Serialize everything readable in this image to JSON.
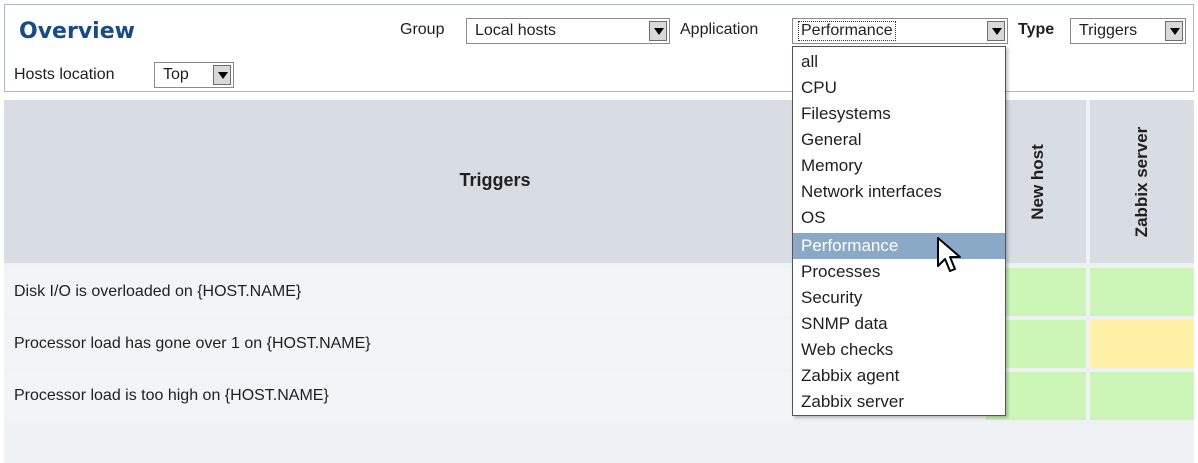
{
  "header": {
    "title": "Overview",
    "group_label": "Group",
    "group_value": "Local hosts",
    "application_label": "Application",
    "application_value": "Performance",
    "type_label": "Type",
    "type_value": "Triggers",
    "hosts_location_label": "Hosts location",
    "hosts_location_value": "Top"
  },
  "table": {
    "triggers_header": "Triggers",
    "hosts": [
      "New host",
      "Zabbix server"
    ],
    "rows": [
      {
        "trigger": "Disk I/O is overloaded on {HOST.NAME}",
        "status": [
          "ok",
          "ok"
        ]
      },
      {
        "trigger": "Processor load has gone over 1 on {HOST.NAME}",
        "status": [
          "ok",
          "warning"
        ]
      },
      {
        "trigger": "Processor load is too high on {HOST.NAME}",
        "status": [
          "ok",
          "ok"
        ]
      }
    ]
  },
  "dropdown": {
    "options": [
      "all",
      "CPU",
      "Filesystems",
      "General",
      "Memory",
      "Network interfaces",
      "OS",
      "Performance",
      "Processes",
      "Security",
      "SNMP data",
      "Web checks",
      "Zabbix agent",
      "Zabbix server"
    ],
    "selected": "Performance"
  },
  "colors": {
    "ok": "#ccf5b8",
    "warning": "#fff0a8",
    "title": "#1a4a85",
    "selected_option": "#8aa9c7"
  },
  "icons": {
    "cursor": "mouse-pointer-icon",
    "select_arrow": "chevron-down-icon"
  }
}
